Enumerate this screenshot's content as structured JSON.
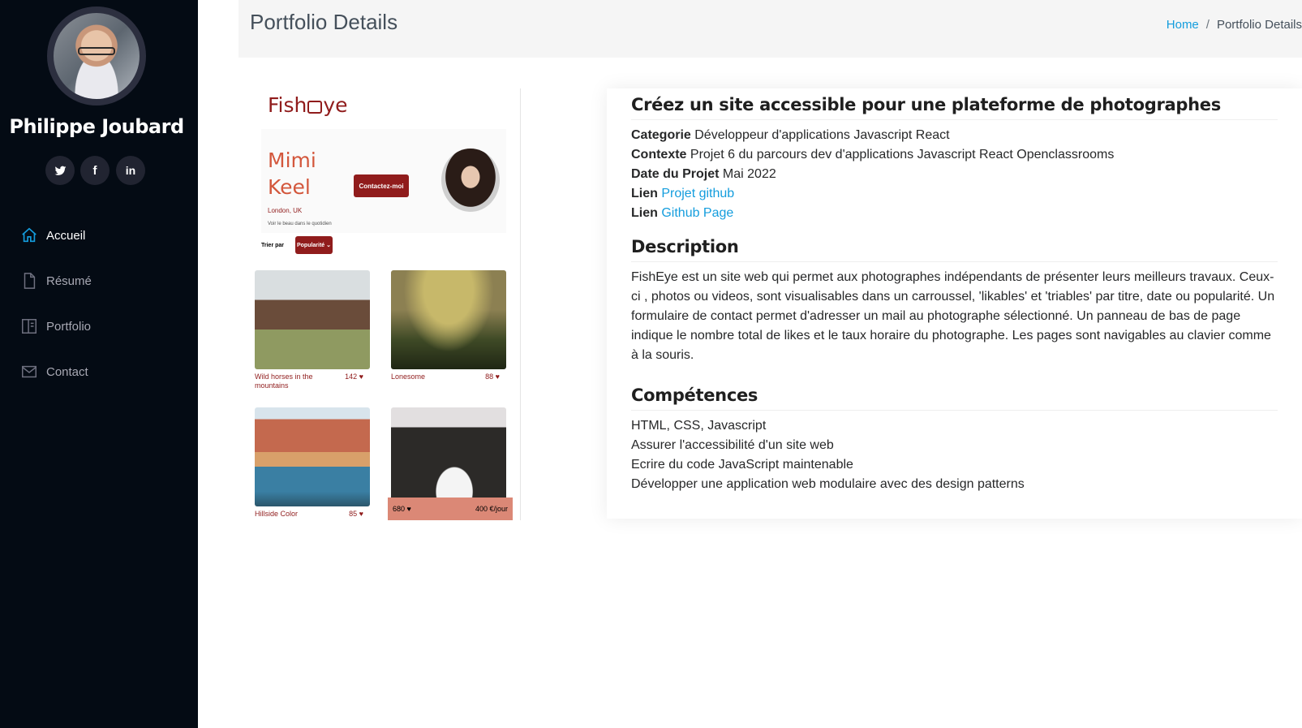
{
  "sidebar": {
    "name": "Philippe Joubard",
    "social": [
      {
        "icon": "twitter-icon",
        "glyph": "🐦"
      },
      {
        "icon": "facebook-icon",
        "glyph": "f"
      },
      {
        "icon": "linkedin-icon",
        "glyph": "in"
      }
    ],
    "nav": [
      {
        "label": "Accueil",
        "icon": "home-icon",
        "active": true
      },
      {
        "label": "Résumé",
        "icon": "file-icon",
        "active": false
      },
      {
        "label": "Portfolio",
        "icon": "book-icon",
        "active": false
      },
      {
        "label": "Contact",
        "icon": "envelope-icon",
        "active": false
      }
    ]
  },
  "header": {
    "title": "Portfolio Details",
    "breadcrumb": {
      "home": "Home",
      "separator": "/",
      "current": "Portfolio Details"
    }
  },
  "screenshot": {
    "logo": "FishEye",
    "photographer": "Mimi Keel",
    "contact_button": "Contactez-moi",
    "location": "London, UK",
    "tagline": "Voir le beau dans le quotidien",
    "sort_label": "Trier par",
    "sort_button": "Popularité",
    "photos": [
      {
        "title": "Wild horses in the mountains",
        "likes": "142"
      },
      {
        "title": "Lonesome",
        "likes": "88"
      },
      {
        "title": "Hillside Color",
        "likes": "85"
      },
      {
        "title": "",
        "likes": ""
      }
    ],
    "footer_likes": "680",
    "footer_rate": "400 €/jour"
  },
  "details": {
    "title": "Créez un site accessible pour une plateforme de photographes",
    "category_label": "Categorie",
    "category_value": "Développeur d'applications Javascript React",
    "context_label": "Contexte",
    "context_value": "Projet 6 du parcours dev d'applications Javascript React Openclassrooms",
    "date_label": "Date du Projet",
    "date_value": "Mai 2022",
    "link1_label": "Lien",
    "link1_text": "Projet github",
    "link2_label": "Lien",
    "link2_text": "Github Page"
  },
  "description": {
    "title": "Description",
    "text": "FishEye est un site web qui permet aux photographes indépendants de présenter leurs meilleurs travaux. Ceux-ci , photos ou videos, sont visualisables dans un carroussel, 'likables' et 'triables' par titre, date ou popularité. Un formulaire de contact permet d'adresser un mail au photographe sélectionné. Un panneau de bas de page indique le nombre total de likes et le taux horaire du photographe. Les pages sont navigables au clavier comme à la souris."
  },
  "skills": {
    "title": "Compétences",
    "items": [
      "HTML, CSS, Javascript",
      "Assurer l'accessibilité d'un site web",
      "Ecrire du code JavaScript maintenable",
      "Développer une application web modulaire avec des design patterns"
    ]
  },
  "colors": {
    "sidebar_bg": "#040b14",
    "accent": "#149ddd",
    "fisheye_red": "#901c1c"
  }
}
